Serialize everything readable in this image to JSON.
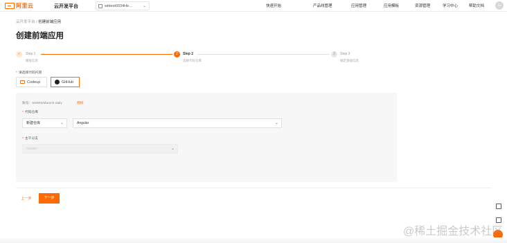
{
  "nav": {
    "logo_text": "阿里云",
    "platform": "云开发平台",
    "workspace": "wbtest0034He...",
    "items": [
      "快速开始",
      "产品线管理",
      "应用管理",
      "应用模板",
      "资源管理",
      "学习中心",
      "帮助文档"
    ],
    "avatar": "AV"
  },
  "breadcrumb": {
    "root": "云开发平台",
    "sep": "/",
    "current": "创建前端应用"
  },
  "page_title": "创建前端应用",
  "steps": [
    {
      "index": "✓",
      "title": "Step 1",
      "desc": "模板信息"
    },
    {
      "index": "2",
      "title": "Step 2",
      "desc": "选择代码仓库"
    },
    {
      "index": "3",
      "title": "Step 3",
      "desc": "确定基础信息"
    }
  ],
  "source": {
    "label": "请选择代码托管",
    "options": [
      "Codeup",
      "GitHub"
    ],
    "selected": "GitHub"
  },
  "panel": {
    "account_label": "账号：",
    "account_value": "testWorkbench-daily",
    "auth_link": "授权",
    "repo_label": "代码仓库",
    "repo_type": "新建仓库",
    "repo_name": "Angular",
    "branch_label": "主干分支",
    "branch_placeholder": "master"
  },
  "footer": {
    "prev": "上一步",
    "next": "下一步"
  },
  "watermark": "@稀土掘金技术社区",
  "colors": {
    "accent": "#ff6a00"
  }
}
